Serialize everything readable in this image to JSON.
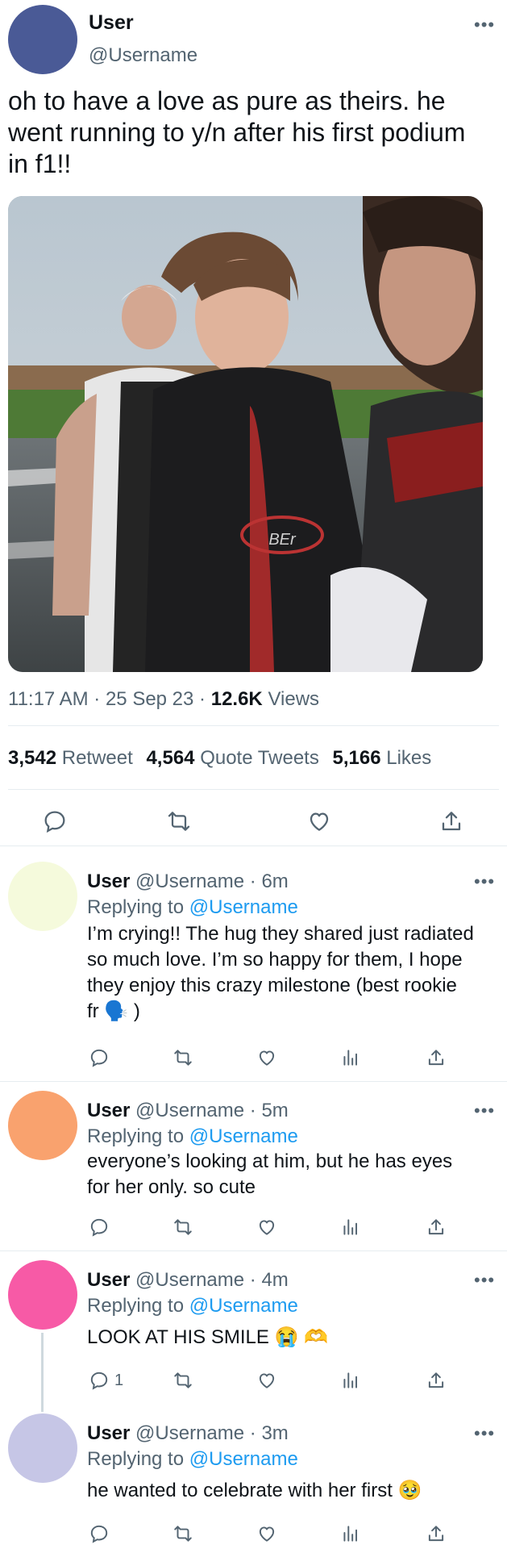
{
  "main_tweet": {
    "display_name": "User",
    "handle": "@Username",
    "avatar_color": "#4a5a96",
    "text": "oh to have a love as pure as theirs. he went running to y/n after his first podium in f1!!",
    "timestamp": "11:17 AM · 25 Sep 23 · ",
    "views_count": "12.6K",
    "views_label": "Views",
    "stats": {
      "retweets_count": "3,542",
      "retweets_label": "Retweet",
      "quotes_count": "4,564",
      "quotes_label": "Quote Tweets",
      "likes_count": "5,166",
      "likes_label": "Likes"
    },
    "photo_logo_text": "BEr"
  },
  "replies": [
    {
      "display_name": "User",
      "handle": "@Username",
      "time": "· 6m",
      "replying_prefix": "Replying to",
      "replying_handle": "@Username",
      "text": "I’m crying!! The hug they shared just radiated so much love. I’m so happy for them, I hope they enjoy this crazy milestone (best rookie fr 🗣️ )",
      "avatar_color": "#f5fadc",
      "reply_count": ""
    },
    {
      "display_name": "User",
      "handle": "@Username",
      "time": "· 5m",
      "replying_prefix": "Replying to",
      "replying_handle": "@Username",
      "text": "everyone’s looking at him, but he has eyes for her only. so cute",
      "avatar_color": "#f9a26e",
      "reply_count": ""
    },
    {
      "display_name": "User",
      "handle": "@Username",
      "time": "· 4m",
      "replying_prefix": "Replying to",
      "replying_handle": "@Username",
      "text": "LOOK AT HIS SMILE 😭 🫶",
      "avatar_color": "#f75aa6",
      "reply_count": "1"
    },
    {
      "display_name": "User",
      "handle": "@Username",
      "time": "· 3m",
      "replying_prefix": "Replying to",
      "replying_handle": "@Username",
      "text": "he wanted to celebrate with her first 🥹",
      "avatar_color": "#c6c6e6",
      "reply_count": ""
    }
  ],
  "icons": {
    "more": "more-horizontal-icon",
    "reply": "reply-bubble-icon",
    "retweet": "retweet-icon",
    "like": "heart-icon",
    "views": "views-bar-chart-icon",
    "share": "share-icon"
  },
  "colors": {
    "accent": "#1d9bf0",
    "secondary_text": "#536471",
    "divider": "#e6ecf0"
  }
}
